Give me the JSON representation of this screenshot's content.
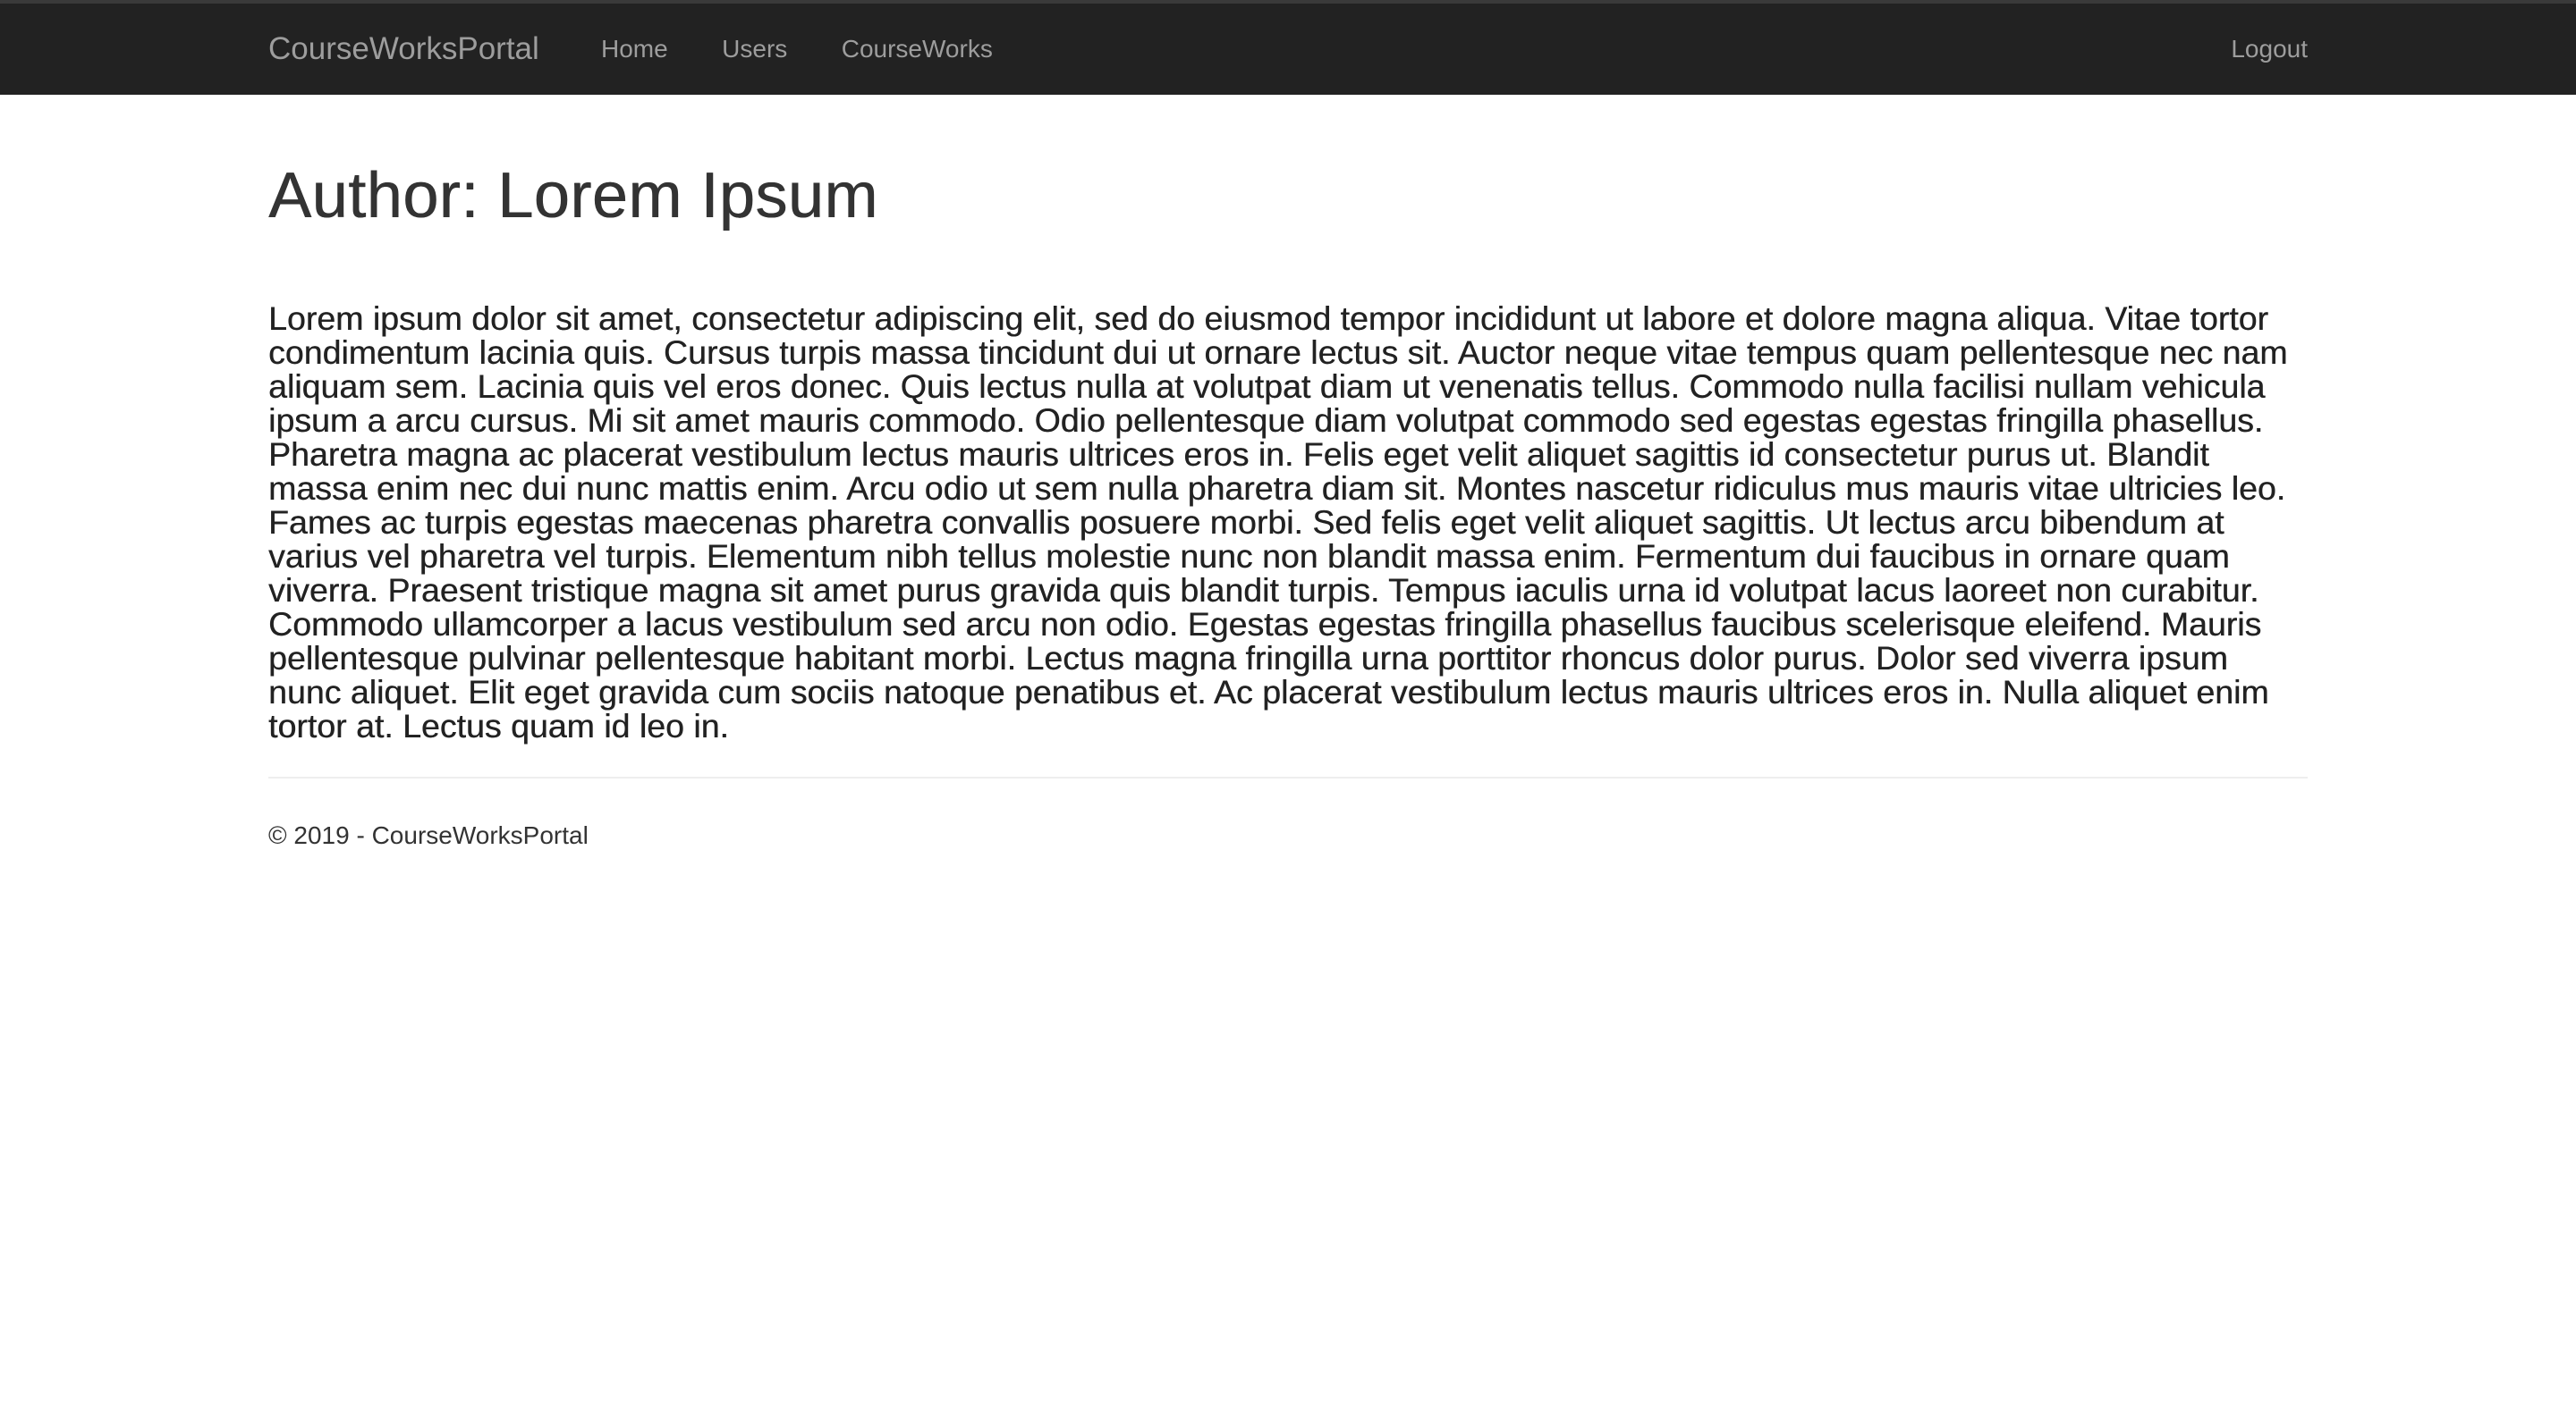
{
  "navbar": {
    "brand": "CourseWorksPortal",
    "links": [
      {
        "label": "Home"
      },
      {
        "label": "Users"
      },
      {
        "label": "CourseWorks"
      }
    ],
    "logout_label": "Logout",
    "background": "#222222",
    "link_color": "#9d9d9d"
  },
  "main": {
    "title": "Author: Lorem Ipsum",
    "bio": "Lorem ipsum dolor sit amet, consectetur adipiscing elit, sed do eiusmod tempor incididunt ut labore et dolore magna aliqua. Vitae tortor condimentum lacinia quis. Cursus turpis massa tincidunt dui ut ornare lectus sit. Auctor neque vitae tempus quam pellentesque nec nam aliquam sem. Lacinia quis vel eros donec. Quis lectus nulla at volutpat diam ut venenatis tellus. Commodo nulla facilisi nullam vehicula ipsum a arcu cursus. Mi sit amet mauris commodo. Odio pellentesque diam volutpat commodo sed egestas egestas fringilla phasellus. Pharetra magna ac placerat vestibulum lectus mauris ultrices eros in. Felis eget velit aliquet sagittis id consectetur purus ut. Blandit massa enim nec dui nunc mattis enim. Arcu odio ut sem nulla pharetra diam sit. Montes nascetur ridiculus mus mauris vitae ultricies leo. Fames ac turpis egestas maecenas pharetra convallis posuere morbi. Sed felis eget velit aliquet sagittis. Ut lectus arcu bibendum at varius vel pharetra vel turpis. Elementum nibh tellus molestie nunc non blandit massa enim. Fermentum dui faucibus in ornare quam viverra. Praesent tristique magna sit amet purus gravida quis blandit turpis. Tempus iaculis urna id volutpat lacus laoreet non curabitur. Commodo ullamcorper a lacus vestibulum sed arcu non odio. Egestas egestas fringilla phasellus faucibus scelerisque eleifend. Mauris pellentesque pulvinar pellentesque habitant morbi. Lectus magna fringilla urna porttitor rhoncus dolor purus. Dolor sed viverra ipsum nunc aliquet. Elit eget gravida cum sociis natoque penatibus et. Ac placerat vestibulum lectus mauris ultrices eros in. Nulla aliquet enim tortor at. Lectus quam id leo in."
  },
  "footer": {
    "text": "© 2019 - CourseWorksPortal"
  }
}
